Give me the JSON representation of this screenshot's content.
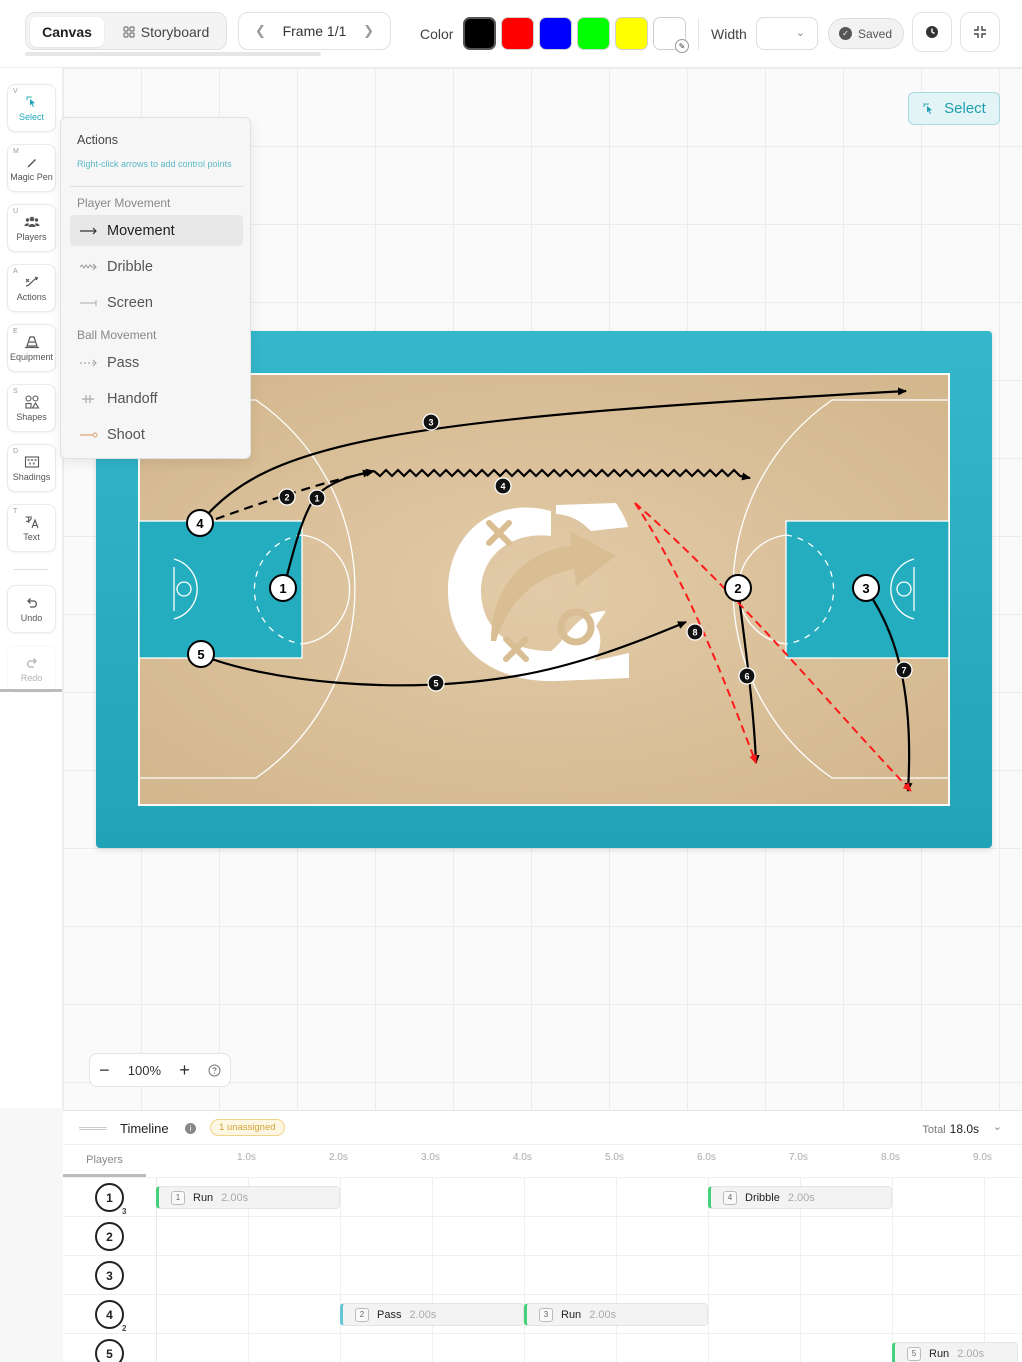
{
  "topbar": {
    "tab_canvas": "Canvas",
    "tab_storyboard": "Storyboard",
    "frame_label": "Frame 1/1",
    "color_label": "Color",
    "colors": [
      "#000000",
      "#ff0000",
      "#0000ff",
      "#00ff00",
      "#ffff00",
      "#ffffff"
    ],
    "width_label": "Width",
    "saved_label": "Saved"
  },
  "tools": [
    {
      "key": "V",
      "label": "Select",
      "icon": "pointer-icon"
    },
    {
      "key": "M",
      "label": "Magic Pen",
      "icon": "pen-icon"
    },
    {
      "key": "U",
      "label": "Players",
      "icon": "players-icon"
    },
    {
      "key": "A",
      "label": "Actions",
      "icon": "actions-icon"
    },
    {
      "key": "E",
      "label": "Equipment",
      "icon": "cone-icon"
    },
    {
      "key": "S",
      "label": "Shapes",
      "icon": "shapes-icon"
    },
    {
      "key": "D",
      "label": "Shadings",
      "icon": "shading-icon"
    },
    {
      "key": "T",
      "label": "Text",
      "icon": "text-icon"
    },
    {
      "key": "",
      "label": "Undo",
      "icon": "undo-icon"
    },
    {
      "key": "",
      "label": "Redo",
      "icon": "redo-icon"
    }
  ],
  "select_chip": "Select",
  "actions_menu": {
    "title": "Actions",
    "hint": "Right-click arrows to add control points",
    "section_player": "Player Movement",
    "section_ball": "Ball Movement",
    "items": [
      "Movement",
      "Dribble",
      "Screen",
      "Pass",
      "Handoff",
      "Shoot"
    ]
  },
  "court": {
    "players": [
      "1",
      "2",
      "3",
      "4",
      "5"
    ],
    "action_numbers": [
      "1",
      "2",
      "3",
      "4",
      "5",
      "6",
      "7",
      "8"
    ],
    "floor_color": "#dcc29c",
    "paint_color": "#22aebf"
  },
  "zoom": {
    "value": "100%"
  },
  "timeline": {
    "title": "Timeline",
    "badge": "1 unassigned",
    "total_label": "Total",
    "total_value": "18.0s",
    "players_header": "Players",
    "ticks": [
      "1.0s",
      "2.0s",
      "3.0s",
      "4.0s",
      "5.0s",
      "6.0s",
      "7.0s",
      "8.0s",
      "9.0s"
    ],
    "rows": [
      {
        "player": "1",
        "sub": "3",
        "blocks": [
          {
            "num": "1",
            "label": "Run",
            "dur": "2.00s"
          },
          {
            "num": "4",
            "label": "Dribble",
            "dur": "2.00s"
          }
        ]
      },
      {
        "player": "2",
        "sub": "",
        "blocks": []
      },
      {
        "player": "3",
        "sub": "",
        "blocks": []
      },
      {
        "player": "4",
        "sub": "2",
        "blocks": [
          {
            "num": "2",
            "label": "Pass",
            "dur": "2.00s"
          },
          {
            "num": "3",
            "label": "Run",
            "dur": "2.00s"
          }
        ]
      },
      {
        "player": "5",
        "sub": "",
        "blocks": [
          {
            "num": "5",
            "label": "Run",
            "dur": "2.00s"
          }
        ]
      }
    ]
  }
}
